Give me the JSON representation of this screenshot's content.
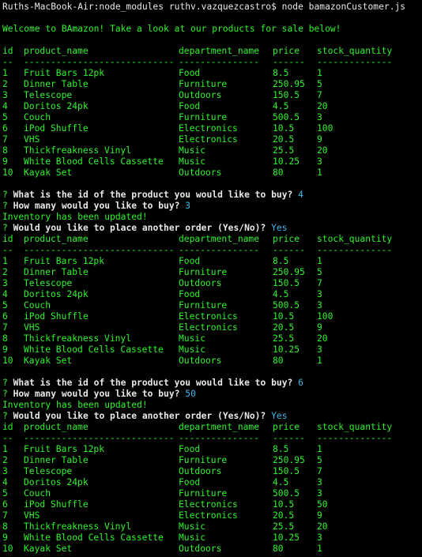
{
  "command_line": "Ruths-MacBook-Air:node_modules ruthv.vazquezcastro$ node bamazonCustomer.js",
  "welcome": "Welcome to BAmazon! Take a look at our products for sale below!",
  "table_header": {
    "id": "id",
    "product_name": "product_name",
    "department_name": "department_name",
    "price": "price",
    "stock_quantity": "stock_quantity"
  },
  "table_divider": {
    "id": "--",
    "product_name": "----------------------------",
    "department_name": "---------------",
    "price": "------",
    "stock_quantity": "--------------"
  },
  "tables": [
    {
      "rows": [
        {
          "id": "1",
          "product_name": "Fruit Bars 12pk",
          "department_name": "Food",
          "price": "8.5",
          "stock_quantity": "1"
        },
        {
          "id": "2",
          "product_name": "Dinner Table",
          "department_name": "Furniture",
          "price": "250.95",
          "stock_quantity": "5"
        },
        {
          "id": "3",
          "product_name": "Telescope",
          "department_name": "Outdoors",
          "price": "150.5",
          "stock_quantity": "7"
        },
        {
          "id": "4",
          "product_name": "Doritos 24pk",
          "department_name": "Food",
          "price": "4.5",
          "stock_quantity": "20"
        },
        {
          "id": "5",
          "product_name": "Couch",
          "department_name": "Furniture",
          "price": "500.5",
          "stock_quantity": "3"
        },
        {
          "id": "6",
          "product_name": "iPod Shuffle",
          "department_name": "Electronics",
          "price": "10.5",
          "stock_quantity": "100"
        },
        {
          "id": "7",
          "product_name": "VHS",
          "department_name": "Electronics",
          "price": "20.5",
          "stock_quantity": "9"
        },
        {
          "id": "8",
          "product_name": "Thickfreakness Vinyl",
          "department_name": "Music",
          "price": "25.5",
          "stock_quantity": "20"
        },
        {
          "id": "9",
          "product_name": "White Blood Cells Cassette",
          "department_name": "Music",
          "price": "10.25",
          "stock_quantity": "3"
        },
        {
          "id": "10",
          "product_name": "Kayak Set",
          "department_name": "Outdoors",
          "price": "80",
          "stock_quantity": "1"
        }
      ]
    },
    {
      "rows": [
        {
          "id": "1",
          "product_name": "Fruit Bars 12pk",
          "department_name": "Food",
          "price": "8.5",
          "stock_quantity": "1"
        },
        {
          "id": "2",
          "product_name": "Dinner Table",
          "department_name": "Furniture",
          "price": "250.95",
          "stock_quantity": "5"
        },
        {
          "id": "3",
          "product_name": "Telescope",
          "department_name": "Outdoors",
          "price": "150.5",
          "stock_quantity": "7"
        },
        {
          "id": "4",
          "product_name": "Doritos 24pk",
          "department_name": "Food",
          "price": "4.5",
          "stock_quantity": "3"
        },
        {
          "id": "5",
          "product_name": "Couch",
          "department_name": "Furniture",
          "price": "500.5",
          "stock_quantity": "3"
        },
        {
          "id": "6",
          "product_name": "iPod Shuffle",
          "department_name": "Electronics",
          "price": "10.5",
          "stock_quantity": "100"
        },
        {
          "id": "7",
          "product_name": "VHS",
          "department_name": "Electronics",
          "price": "20.5",
          "stock_quantity": "9"
        },
        {
          "id": "8",
          "product_name": "Thickfreakness Vinyl",
          "department_name": "Music",
          "price": "25.5",
          "stock_quantity": "20"
        },
        {
          "id": "9",
          "product_name": "White Blood Cells Cassette",
          "department_name": "Music",
          "price": "10.25",
          "stock_quantity": "3"
        },
        {
          "id": "10",
          "product_name": "Kayak Set",
          "department_name": "Outdoors",
          "price": "80",
          "stock_quantity": "1"
        }
      ]
    },
    {
      "rows": [
        {
          "id": "1",
          "product_name": "Fruit Bars 12pk",
          "department_name": "Food",
          "price": "8.5",
          "stock_quantity": "1"
        },
        {
          "id": "2",
          "product_name": "Dinner Table",
          "department_name": "Furniture",
          "price": "250.95",
          "stock_quantity": "5"
        },
        {
          "id": "3",
          "product_name": "Telescope",
          "department_name": "Outdoors",
          "price": "150.5",
          "stock_quantity": "7"
        },
        {
          "id": "4",
          "product_name": "Doritos 24pk",
          "department_name": "Food",
          "price": "4.5",
          "stock_quantity": "3"
        },
        {
          "id": "5",
          "product_name": "Couch",
          "department_name": "Furniture",
          "price": "500.5",
          "stock_quantity": "3"
        },
        {
          "id": "6",
          "product_name": "iPod Shuffle",
          "department_name": "Electronics",
          "price": "10.5",
          "stock_quantity": "50"
        },
        {
          "id": "7",
          "product_name": "VHS",
          "department_name": "Electronics",
          "price": "20.5",
          "stock_quantity": "9"
        },
        {
          "id": "8",
          "product_name": "Thickfreakness Vinyl",
          "department_name": "Music",
          "price": "25.5",
          "stock_quantity": "20"
        },
        {
          "id": "9",
          "product_name": "White Blood Cells Cassette",
          "department_name": "Music",
          "price": "10.25",
          "stock_quantity": "3"
        },
        {
          "id": "10",
          "product_name": "Kayak Set",
          "department_name": "Outdoors",
          "price": "80",
          "stock_quantity": "1"
        }
      ]
    }
  ],
  "interactions": [
    {
      "q_mark": "?",
      "id_question": "What is the id of the product you would like to buy?",
      "id_answer": "4",
      "qty_question": "How many would you like to buy?",
      "qty_answer": "3",
      "update_message": "Inventory has been updated!",
      "again_question": "Would you like to place another order (Yes/No)?",
      "again_answer": "Yes"
    },
    {
      "q_mark": "?",
      "id_question": "What is the id of the product you would like to buy?",
      "id_answer": "6",
      "qty_question": "How many would you like to buy?",
      "qty_answer": "50",
      "update_message": "Inventory has been updated!",
      "again_question": "Would you like to place another order (Yes/No)?",
      "again_answer": "Yes"
    }
  ],
  "colors": {
    "background": "#000000",
    "output_text": "#2ff32c",
    "prompt_text": "#e8e8e8",
    "answer_text": "#3fb6e8"
  }
}
